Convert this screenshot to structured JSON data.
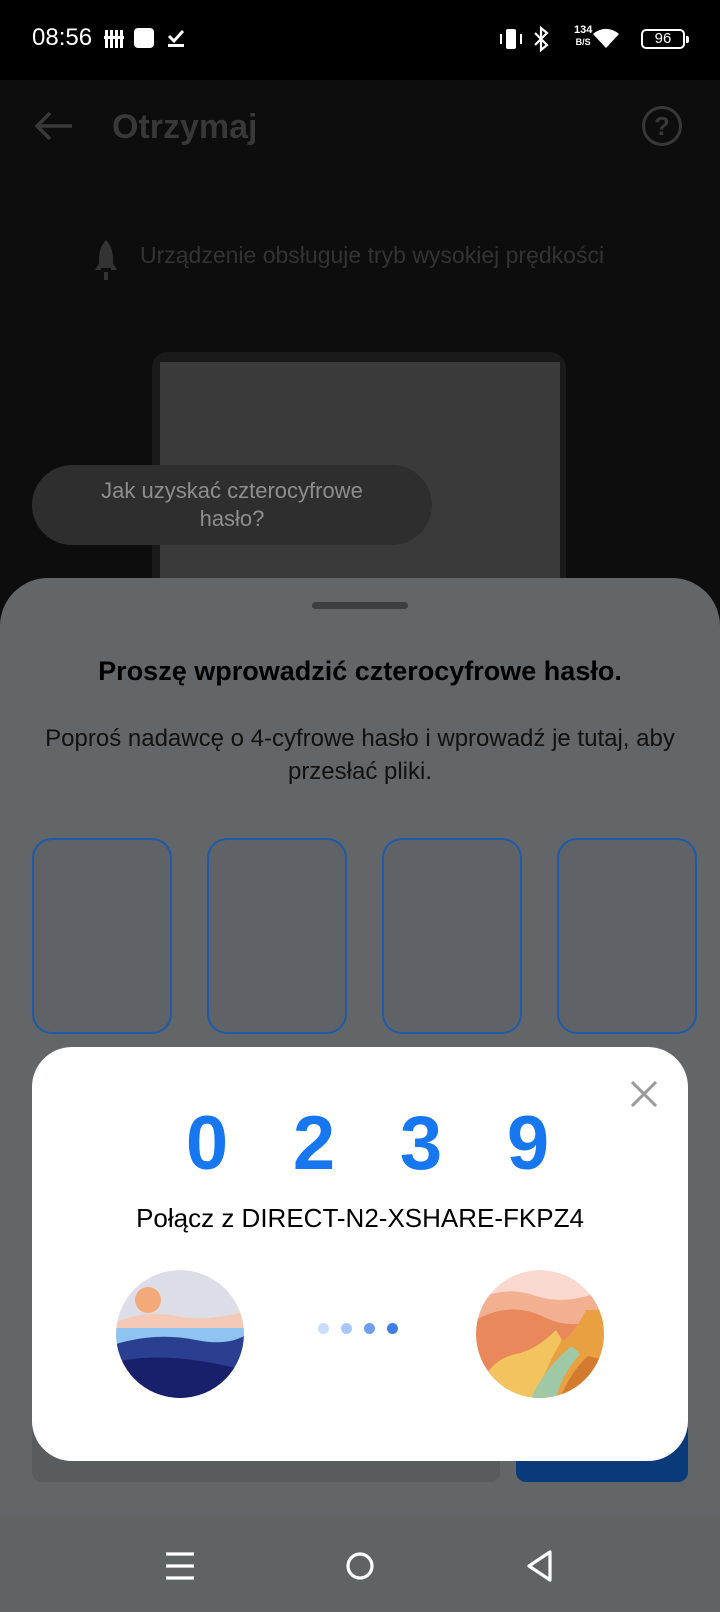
{
  "status_bar": {
    "time": "08:56",
    "net_speed_value": "134",
    "net_speed_unit": "B/S",
    "battery": "96"
  },
  "header": {
    "title": "Otrzymaj",
    "back_icon": "arrow-left-icon",
    "help_icon": "question-circle-icon",
    "help_glyph": "?"
  },
  "speed_notice": "Urządzenie obsługuje tryb wysokiej prędkości",
  "help_link": "Jak uzyskać czterocyfrowe hasło?",
  "sheet": {
    "title": "Proszę wprowadzić czterocyfrowe hasło.",
    "description": "Poproś nadawcę o 4-cyfrowe hasło i wprowadź je tutaj, aby przesłać pliki."
  },
  "dialog": {
    "code": [
      "0",
      "2",
      "3",
      "9"
    ],
    "connect_text": "Połącz z DIRECT-N2-XSHARE-FKPZ4",
    "close_icon": "close-icon"
  },
  "colors": {
    "accent": "#1677f0",
    "sheet_overlay": "#636668",
    "input_border": "#1e5aa8",
    "dot_light": "#bcd3fb",
    "dot_dark": "#3f7de8"
  },
  "nav_icons": [
    "menu-icon",
    "home-icon",
    "back-triangle-icon"
  ]
}
